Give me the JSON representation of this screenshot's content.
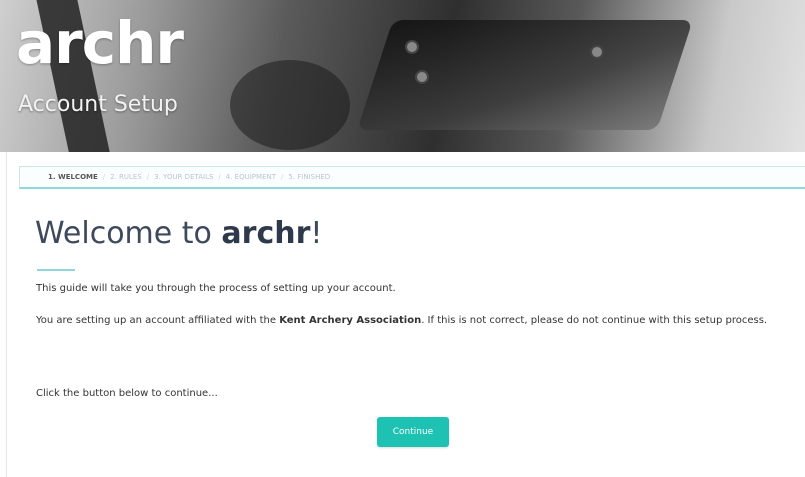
{
  "brand": {
    "logo_text": "archr",
    "subtitle": "Account Setup"
  },
  "steps": [
    {
      "label": "1. WELCOME",
      "active": true
    },
    {
      "label": "2. RULES",
      "active": false
    },
    {
      "label": "3. YOUR DETAILS",
      "active": false
    },
    {
      "label": "4. EQUIPMENT",
      "active": false
    },
    {
      "label": "5. FINISHED",
      "active": false
    }
  ],
  "steps_separator": "/",
  "main": {
    "heading_prefix": "Welcome to ",
    "heading_brand": "archr",
    "heading_suffix": "!",
    "intro": "This guide will take you through the process of setting up your account.",
    "affiliation_before": "You are setting up an account affiliated with the ",
    "affiliation_org": "Kent Archery Association",
    "affiliation_after": ". If this is not correct, please do not continue with this setup process.",
    "prompt": "Click the button below to continue...",
    "continue_label": "Continue"
  },
  "colors": {
    "accent": "#1ec2b3",
    "heading": "#3e4a5c"
  }
}
